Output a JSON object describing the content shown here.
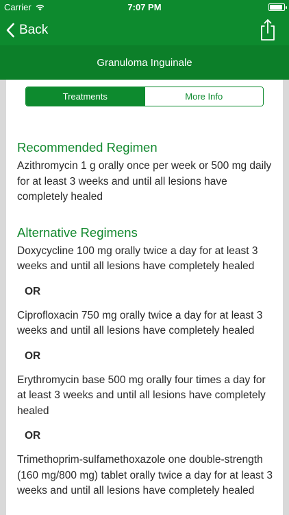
{
  "status_bar": {
    "carrier": "Carrier",
    "time": "7:07 PM",
    "battery_level": 0.9
  },
  "nav": {
    "back_label": "Back",
    "share_icon": "share-icon"
  },
  "title_bar": {
    "title": "Granuloma Inguinale"
  },
  "tabs": [
    {
      "label": "Treatments",
      "selected": true
    },
    {
      "label": "More Info",
      "selected": false
    }
  ],
  "recommended": {
    "heading": "Recommended Regimen",
    "text": "Azithromycin 1 g orally once per week or 500 mg daily for at least 3 weeks and until all lesions have completely healed"
  },
  "alternative": {
    "heading": "Alternative Regimens",
    "or_label": "OR",
    "regimens": [
      "Doxycycline 100 mg orally twice a day for at least 3 weeks and until all lesions have completely healed",
      "Ciprofloxacin 750 mg orally twice a day for at least 3 weeks and until all lesions have completely healed",
      "Erythromycin base 500 mg orally four times a day for at least 3 weeks and until all lesions have completely healed",
      "Trimethoprim-sulfamethoxazole one double-strength (160 mg/800 mg) tablet orally twice a day for at least 3 weeks and until all lesions have completely healed"
    ]
  },
  "colors": {
    "brand_green": "#0d8a2e",
    "heading_green": "#13892f",
    "gutter_gray": "#d9d9d9"
  }
}
